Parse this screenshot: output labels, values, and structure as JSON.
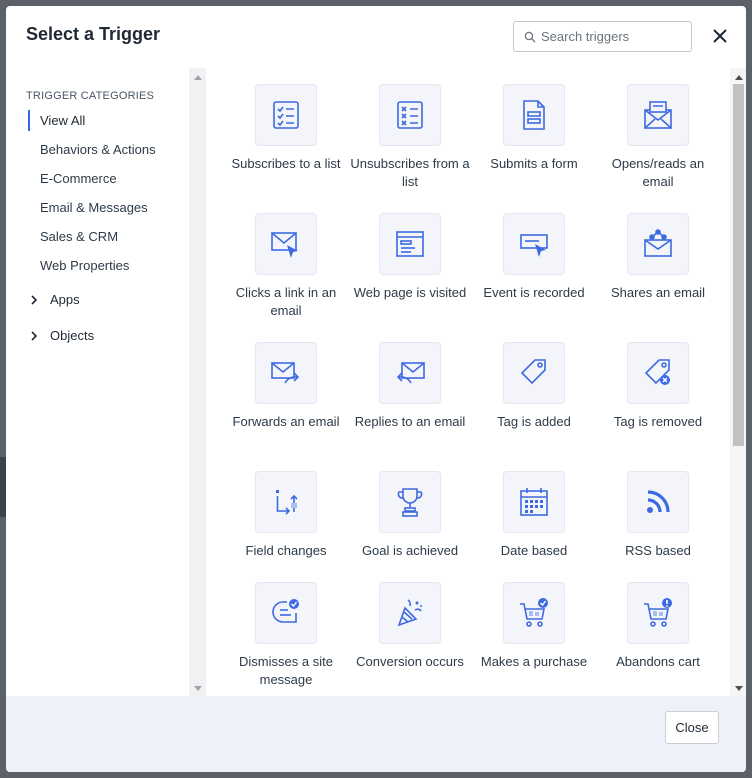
{
  "modal": {
    "title": "Select a Trigger",
    "search_placeholder": "Search triggers",
    "close_button_label": "Close"
  },
  "sidebar": {
    "heading": "TRIGGER CATEGORIES",
    "categories": [
      {
        "label": "View All",
        "active": true
      },
      {
        "label": "Behaviors & Actions"
      },
      {
        "label": "E-Commerce"
      },
      {
        "label": "Email & Messages"
      },
      {
        "label": "Sales & CRM"
      },
      {
        "label": "Web Properties"
      }
    ],
    "groups": [
      {
        "label": "Apps",
        "icon": "chevron-right-icon"
      },
      {
        "label": "Objects",
        "icon": "chevron-right-icon"
      }
    ]
  },
  "colors": {
    "accent": "#356ae6",
    "icon_fill": "#3d6ae0",
    "tile_bg": "#f3f5fb",
    "footer_bg": "#eef1f9"
  },
  "triggers": [
    {
      "label": "Subscribes to a list",
      "icon": "checklist-icon"
    },
    {
      "label": "Unsubscribes from a list",
      "icon": "cancel-list-icon"
    },
    {
      "label": "Submits a form",
      "icon": "form-icon"
    },
    {
      "label": "Opens/reads an email",
      "icon": "open-envelope-icon"
    },
    {
      "label": "Clicks a link in an email",
      "icon": "envelope-cursor-icon"
    },
    {
      "label": "Web page is visited",
      "icon": "browser-window-icon"
    },
    {
      "label": "Event is recorded",
      "icon": "event-cursor-icon"
    },
    {
      "label": "Shares an email",
      "icon": "share-envelope-icon"
    },
    {
      "label": "Forwards an email",
      "icon": "forward-envelope-icon"
    },
    {
      "label": "Replies to an email",
      "icon": "reply-envelope-icon"
    },
    {
      "label": "Tag is added",
      "icon": "tag-icon"
    },
    {
      "label": "Tag is removed",
      "icon": "tag-remove-icon"
    },
    {
      "label": "Field changes",
      "icon": "field-change-icon"
    },
    {
      "label": "Goal is achieved",
      "icon": "trophy-icon"
    },
    {
      "label": "Date based",
      "icon": "calendar-icon"
    },
    {
      "label": "RSS based",
      "icon": "rss-icon"
    },
    {
      "label": "Dismisses a site message",
      "icon": "site-message-icon"
    },
    {
      "label": "Conversion occurs",
      "icon": "party-popper-icon"
    },
    {
      "label": "Makes a purchase",
      "icon": "cart-check-icon"
    },
    {
      "label": "Abandons cart",
      "icon": "cart-alert-icon"
    }
  ]
}
